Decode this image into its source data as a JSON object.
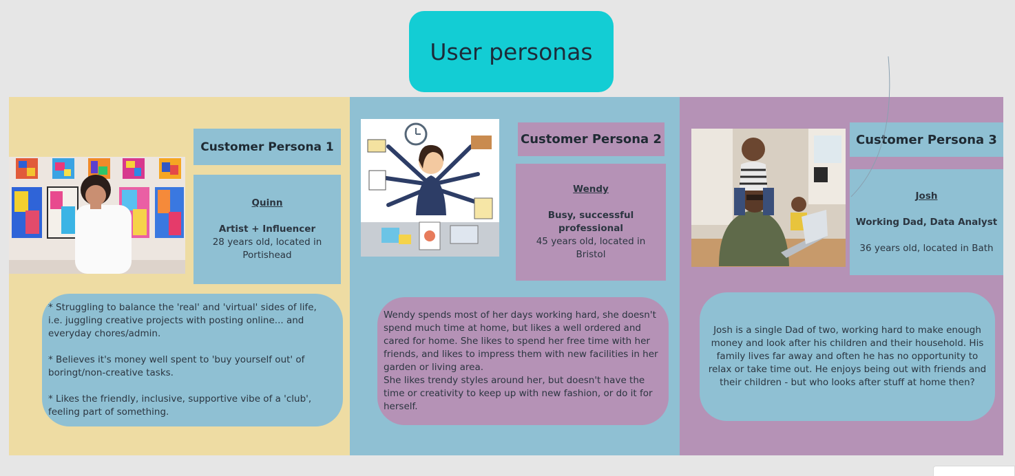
{
  "board": {
    "title": "User personas"
  },
  "personas": [
    {
      "heading": "Customer Persona 1",
      "name": "Quinn",
      "role": "Artist + Influencer",
      "details": "28 years old, located in Portishead",
      "notes": "* Struggling to balance the 'real' and 'virtual' sides of life, i.e. juggling creative projects with posting online... and everyday chores/admin.\n\n* Believes it's money well spent to 'buy yourself out' of boringt/non-creative tasks.\n\n* Likes the friendly, inclusive, supportive vibe of a 'club', feeling part of something."
    },
    {
      "heading": "Customer Persona 2",
      "name": "Wendy",
      "role": "Busy, successful professional",
      "details": "45 years old, located in Bristol",
      "notes": "Wendy spends most of her days working hard, she doesn't spend much time at home, but likes a well ordered and cared for home. She likes to spend her free time with her friends, and likes to impress them with new facilities in her garden or living area.\nShe likes trendy styles around her, but doesn't have the time or creativity to keep up with new fashion, or do it for herself."
    },
    {
      "heading": "Customer Persona 3",
      "name": "Josh",
      "role": "Working Dad, Data Analyst",
      "details": "36 years old, located in Bath",
      "notes": "Josh is a single Dad of two, working hard to make enough money and look after his children and their household. His family lives far away and often he has no opportunity to relax or take time out. He enjoys being out with friends and their children - but who looks after stuff at home then?"
    }
  ],
  "colors": {
    "title_bg": "#13cdd4",
    "panel_1": "#eedca3",
    "panel_2": "#8fc0d3",
    "panel_3": "#b592b6"
  }
}
